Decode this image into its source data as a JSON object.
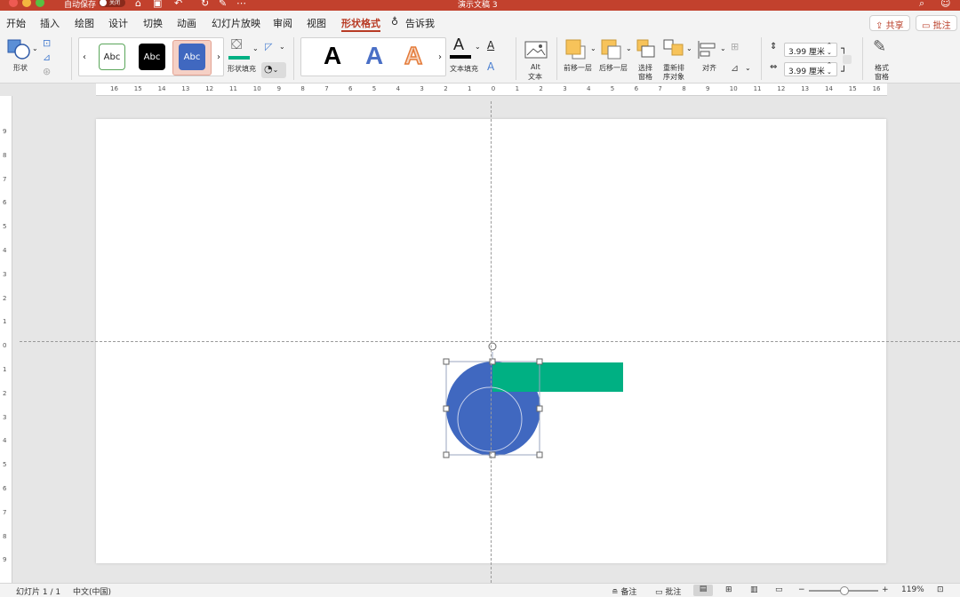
{
  "titlebar": {
    "autosave_label": "自动保存",
    "autosave_state": "关闭",
    "doc_title": "演示文稿 3",
    "more_icon": "⋯"
  },
  "tabs": [
    "开始",
    "插入",
    "绘图",
    "设计",
    "切换",
    "动画",
    "幻灯片放映",
    "审阅",
    "视图",
    "形状格式"
  ],
  "tell_me": "告诉我",
  "share_label": "共享",
  "comment_label": "批注",
  "ribbon": {
    "shape_label": "形状",
    "style_swatch_text": "Abc",
    "shape_fill_label": "形状填充",
    "wordart_letter": "A",
    "text_fill_label": "文本填充",
    "alt_text_label_1": "Alt",
    "alt_text_label_2": "文本",
    "bring_forward_label": "前移一层",
    "send_backward_label": "后移一层",
    "selection_pane_label_1": "选择",
    "selection_pane_label_2": "窗格",
    "reorder_label_1": "重新排",
    "reorder_label_2": "序对象",
    "align_label": "对齐",
    "height_value": "3.99 厘米",
    "width_value": "3.99 厘米",
    "format_pane_label_1": "格式",
    "format_pane_label_2": "窗格"
  },
  "ruler": {
    "h_labels": [
      "16",
      "15",
      "14",
      "13",
      "12",
      "11",
      "10",
      "9",
      "8",
      "7",
      "6",
      "5",
      "4",
      "3",
      "2",
      "1",
      "0",
      "1",
      "2",
      "3",
      "4",
      "5",
      "6",
      "7",
      "8",
      "9",
      "10",
      "11",
      "12",
      "13",
      "14",
      "15",
      "16"
    ],
    "v_labels": [
      "9",
      "8",
      "7",
      "6",
      "5",
      "4",
      "3",
      "2",
      "1",
      "0",
      "1",
      "2",
      "3",
      "4",
      "5",
      "6",
      "7",
      "8",
      "9"
    ]
  },
  "colors": {
    "accent": "#b83b25",
    "shape_blue": "#4068c0",
    "shape_green": "#00b083",
    "fill_bar": "#00b083"
  },
  "status": {
    "slide_info": "幻灯片 1 / 1",
    "language": "中文(中国)",
    "notes_label": "备注",
    "comments_label": "批注",
    "zoom": "119%"
  }
}
